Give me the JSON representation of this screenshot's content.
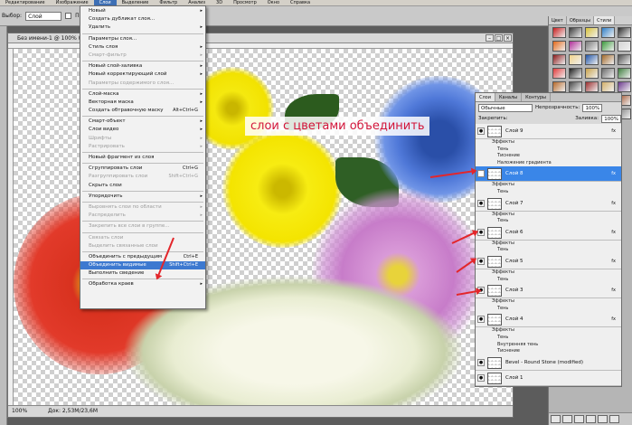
{
  "menubar": {
    "items": [
      "Редактирование",
      "Изображение",
      "Слои",
      "Выделение",
      "Фильтр",
      "Анализ",
      "3D",
      "Просмотр",
      "Окно",
      "Справка"
    ],
    "active_index": 2
  },
  "options": {
    "select_label": "Выбор:",
    "select_value": "Слой",
    "show_label": "Показ"
  },
  "document": {
    "title": "Без имени-1 @ 100% (Слой 8...",
    "zoom": "100%",
    "doc_size": "Док: 2,53M/23,6M"
  },
  "annotation": "слои с цветами объединить",
  "layer_menu": [
    {
      "label": "Новый",
      "arrow": true
    },
    {
      "label": "Создать дубликат слоя..."
    },
    {
      "label": "Удалить",
      "arrow": true
    },
    {
      "sep": true
    },
    {
      "label": "Параметры слоя..."
    },
    {
      "label": "Стиль слоя",
      "arrow": true
    },
    {
      "label": "Смарт-фильтр",
      "disabled": true,
      "arrow": true
    },
    {
      "sep": true
    },
    {
      "label": "Новый слой-заливка",
      "arrow": true
    },
    {
      "label": "Новый корректирующий слой",
      "arrow": true
    },
    {
      "label": "Параметры содержимого слоя...",
      "disabled": true
    },
    {
      "sep": true
    },
    {
      "label": "Слой-маска",
      "arrow": true
    },
    {
      "label": "Векторная маска",
      "arrow": true
    },
    {
      "label": "Создать обтравочную маску",
      "shortcut": "Alt+Ctrl+G"
    },
    {
      "sep": true
    },
    {
      "label": "Смарт-объект",
      "arrow": true
    },
    {
      "label": "Слои видео",
      "arrow": true
    },
    {
      "label": "Шрифты",
      "disabled": true,
      "arrow": true
    },
    {
      "label": "Растрировать",
      "disabled": true,
      "arrow": true
    },
    {
      "sep": true
    },
    {
      "label": "Новый фрагмент из слоя"
    },
    {
      "sep": true
    },
    {
      "label": "Сгруппировать слои",
      "shortcut": "Ctrl+G"
    },
    {
      "label": "Разгруппировать слои",
      "shortcut": "Shift+Ctrl+G",
      "disabled": true
    },
    {
      "label": "Скрыть слои"
    },
    {
      "sep": true
    },
    {
      "label": "Упорядочить",
      "arrow": true
    },
    {
      "sep": true
    },
    {
      "label": "Выровнять слои по области",
      "disabled": true,
      "arrow": true
    },
    {
      "label": "Распределить",
      "disabled": true,
      "arrow": true
    },
    {
      "sep": true
    },
    {
      "label": "Закрепить все слои в группе...",
      "disabled": true
    },
    {
      "sep": true
    },
    {
      "label": "Связать слои",
      "disabled": true
    },
    {
      "label": "Выделить связанные слои",
      "disabled": true
    },
    {
      "sep": true
    },
    {
      "label": "Объединить с предыдущим",
      "shortcut": "Ctrl+E"
    },
    {
      "label": "Объединить видимые",
      "shortcut": "Shift+Ctrl+E",
      "highlighted": true
    },
    {
      "label": "Выполнить сведение"
    },
    {
      "sep": true
    },
    {
      "label": "Обработка краев",
      "arrow": true
    }
  ],
  "swatches_tabs": [
    "Цвет",
    "Образцы",
    "Стили"
  ],
  "swatch_colors": [
    "#c81e1e",
    "#3a3a3a",
    "#d8c23a",
    "#2f7fc9",
    "#2c2c2c",
    "#e46a1a",
    "#b12f9a",
    "#7a7a7a",
    "#3c9c3c",
    "#d3d3d3",
    "#8c1c1c",
    "#f2d38a",
    "#2356a8",
    "#a36a2a",
    "#505050",
    "#e23b3b",
    "#1f1f1f",
    "#c9a24a",
    "#6b6b6b",
    "#3f7f3f",
    "#b86a2a",
    "#4a4a4a",
    "#9c2f2f",
    "#d4b06a",
    "#6e3b8f",
    "#2a2a2a",
    "#cc3b3b",
    "#5b8fd6",
    "#9b9b9b",
    "#a0522d",
    "#d7c3a0",
    "#474747",
    "#b03a2e",
    "#4f7fb0",
    "#808080"
  ],
  "layers": {
    "tabs": [
      "Слои",
      "Каналы",
      "Контуры"
    ],
    "blend_mode": "Обычные",
    "opacity_label": "Непрозрачность:",
    "opacity_value": "100%",
    "lock_label": "Закрепить:",
    "fill_label": "Заливка:",
    "fill_value": "100%",
    "rows": [
      {
        "type": "layer",
        "name": "Слой 9",
        "fx": "fx"
      },
      {
        "type": "sub",
        "name": "Эффекты"
      },
      {
        "type": "sub",
        "name": "Тень"
      },
      {
        "type": "sub",
        "name": "Тиснение"
      },
      {
        "type": "sub",
        "name": "Наложение градиента"
      },
      {
        "type": "layer",
        "name": "Слой 8",
        "fx": "fx",
        "selected": true
      },
      {
        "type": "sub",
        "name": "Эффекты"
      },
      {
        "type": "sub",
        "name": "Тень"
      },
      {
        "type": "layer",
        "name": "Слой 7",
        "fx": "fx"
      },
      {
        "type": "sub",
        "name": "Эффекты"
      },
      {
        "type": "sub",
        "name": "Тень"
      },
      {
        "type": "layer",
        "name": "Слой 6",
        "fx": "fx"
      },
      {
        "type": "sub",
        "name": "Эффекты"
      },
      {
        "type": "sub",
        "name": "Тень"
      },
      {
        "type": "layer",
        "name": "Слой 5",
        "fx": "fx"
      },
      {
        "type": "sub",
        "name": "Эффекты"
      },
      {
        "type": "sub",
        "name": "Тень"
      },
      {
        "type": "layer",
        "name": "Слой 3",
        "fx": "fx"
      },
      {
        "type": "sub",
        "name": "Эффекты"
      },
      {
        "type": "sub",
        "name": "Тень"
      },
      {
        "type": "layer",
        "name": "Слой 4",
        "fx": "fx"
      },
      {
        "type": "sub",
        "name": "Эффекты"
      },
      {
        "type": "sub",
        "name": "Тень"
      },
      {
        "type": "sub",
        "name": "Внутренняя тень"
      },
      {
        "type": "sub",
        "name": "Тиснение"
      },
      {
        "type": "layer",
        "name": "Bevel - Round Stone (modified)"
      },
      {
        "type": "layer",
        "name": "Слой 1"
      }
    ]
  }
}
